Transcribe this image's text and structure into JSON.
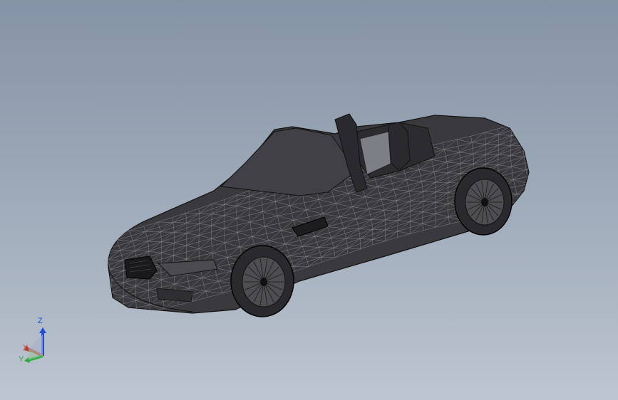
{
  "triad": {
    "x_label": "X",
    "y_label": "Y",
    "z_label": "Z",
    "colors": {
      "x": "#c0392b",
      "y": "#27ae3a",
      "z": "#1f4fd1"
    }
  },
  "viewport": {
    "background_top": "#8593a6",
    "background_bottom": "#bdc5d0"
  }
}
